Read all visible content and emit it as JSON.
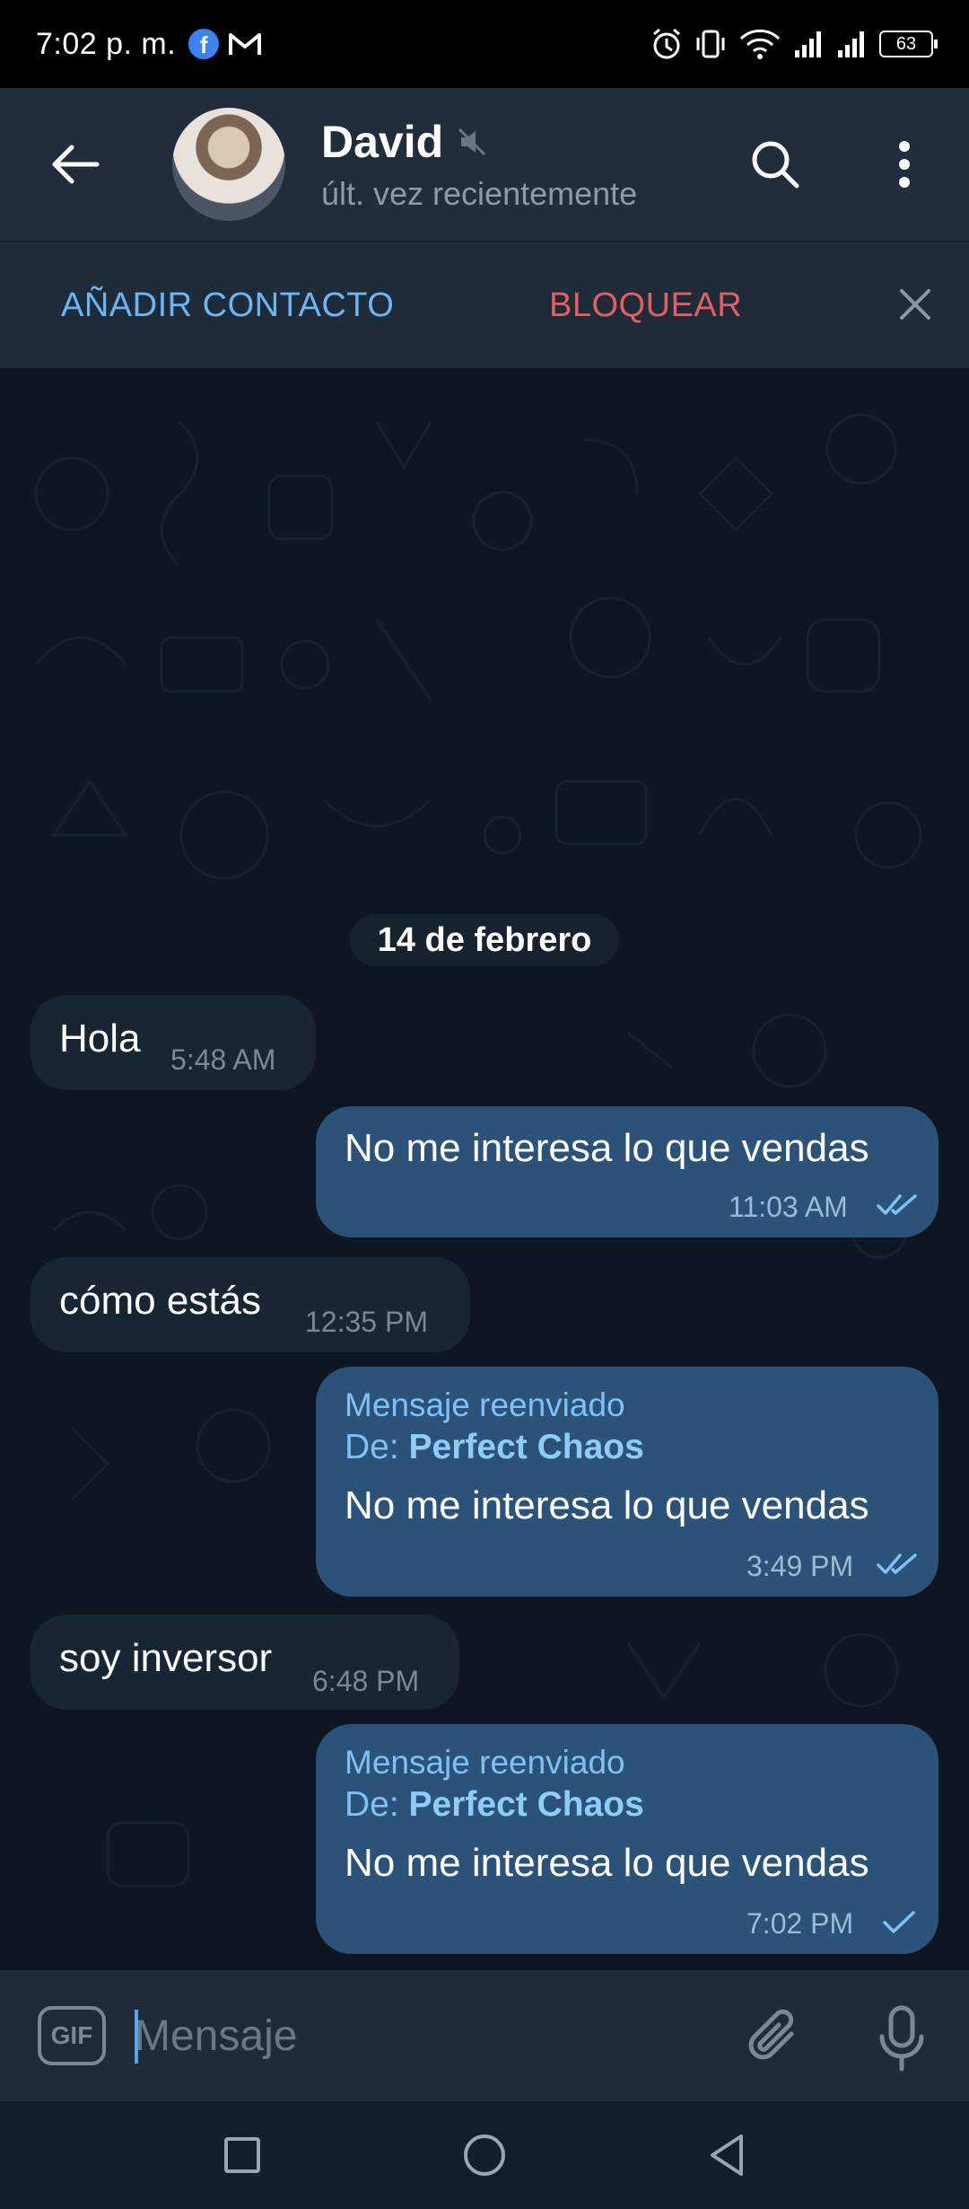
{
  "status_bar": {
    "time": "7:02 p. m.",
    "battery": "63",
    "notification_icons": [
      "facebook-icon",
      "gmail-icon"
    ],
    "system_icons": [
      "alarm-icon",
      "vibrate-icon",
      "wifi-icon",
      "signal-icon",
      "signal-icon",
      "battery-icon"
    ]
  },
  "header": {
    "contact_name": "David",
    "status": "últ. vez recientemente",
    "muted": true
  },
  "action_bar": {
    "add_contact": "AÑADIR CONTACTO",
    "block": "BLOQUEAR"
  },
  "chat": {
    "date_separator": "14 de febrero",
    "messages": [
      {
        "direction": "in",
        "text": "Hola",
        "time": "5:48 AM"
      },
      {
        "direction": "out",
        "text": "No me interesa lo que vendas",
        "time": "11:03 AM",
        "status": "read"
      },
      {
        "direction": "in",
        "text": "cómo estás",
        "time": "12:35 PM"
      },
      {
        "direction": "out",
        "forwarded_label": "Mensaje reenviado",
        "from_prefix": "De:",
        "from_name": "Perfect Chaos",
        "text": "No me interesa lo que vendas",
        "time": "3:49 PM",
        "status": "read"
      },
      {
        "direction": "in",
        "text": "soy inversor",
        "time": "6:48 PM"
      },
      {
        "direction": "out",
        "forwarded_label": "Mensaje reenviado",
        "from_prefix": "De:",
        "from_name": "Perfect Chaos",
        "text": "No me interesa lo que vendas",
        "time": "7:02 PM",
        "status": "sent"
      }
    ]
  },
  "input_bar": {
    "gif_label": "GIF",
    "placeholder": "Mensaje"
  },
  "colors": {
    "header_bg": "#212d3b",
    "chat_bg": "#0e1621",
    "incoming_bubble": "#182533",
    "outgoing_bubble": "#2b5278",
    "accent_blue": "#6cb5f5",
    "danger_red": "#e35f5f"
  }
}
